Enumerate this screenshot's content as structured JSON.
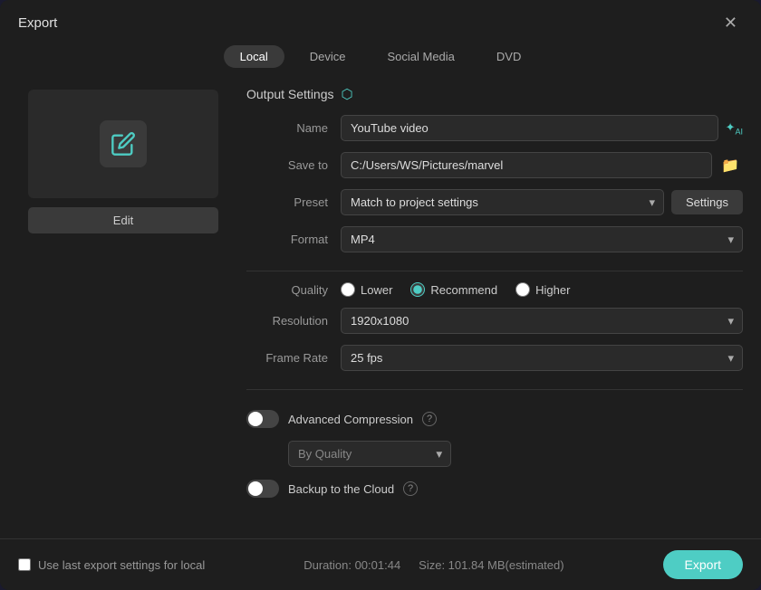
{
  "modal": {
    "title": "Export"
  },
  "tabs": [
    {
      "id": "local",
      "label": "Local",
      "active": true
    },
    {
      "id": "device",
      "label": "Device",
      "active": false
    },
    {
      "id": "social-media",
      "label": "Social Media",
      "active": false
    },
    {
      "id": "dvd",
      "label": "DVD",
      "active": false
    }
  ],
  "output_settings": {
    "header": "Output Settings",
    "fields": {
      "name_label": "Name",
      "name_value": "YouTube video",
      "save_to_label": "Save to",
      "save_to_value": "C:/Users/WS/Pictures/marvel",
      "preset_label": "Preset",
      "preset_value": "Match to project settings",
      "format_label": "Format",
      "format_value": "MP4",
      "quality_label": "Quality",
      "resolution_label": "Resolution",
      "resolution_value": "1920x1080",
      "frame_rate_label": "Frame Rate",
      "frame_rate_value": "25 fps"
    }
  },
  "quality_options": [
    {
      "id": "lower",
      "label": "Lower",
      "checked": false
    },
    {
      "id": "recommend",
      "label": "Recommend",
      "checked": true
    },
    {
      "id": "higher",
      "label": "Higher",
      "checked": false
    }
  ],
  "toggles": {
    "advanced_compression": {
      "label": "Advanced Compression",
      "enabled": false
    },
    "backup_cloud": {
      "label": "Backup to the Cloud",
      "enabled": false
    }
  },
  "compression_options": [
    {
      "value": "by-quality",
      "label": "By Quality"
    }
  ],
  "settings_button": "Settings",
  "edit_button": "Edit",
  "footer": {
    "checkbox_label": "Use last export settings for local",
    "duration_label": "Duration: 00:01:44",
    "size_label": "Size: 101.84 MB(estimated)",
    "export_button": "Export"
  }
}
